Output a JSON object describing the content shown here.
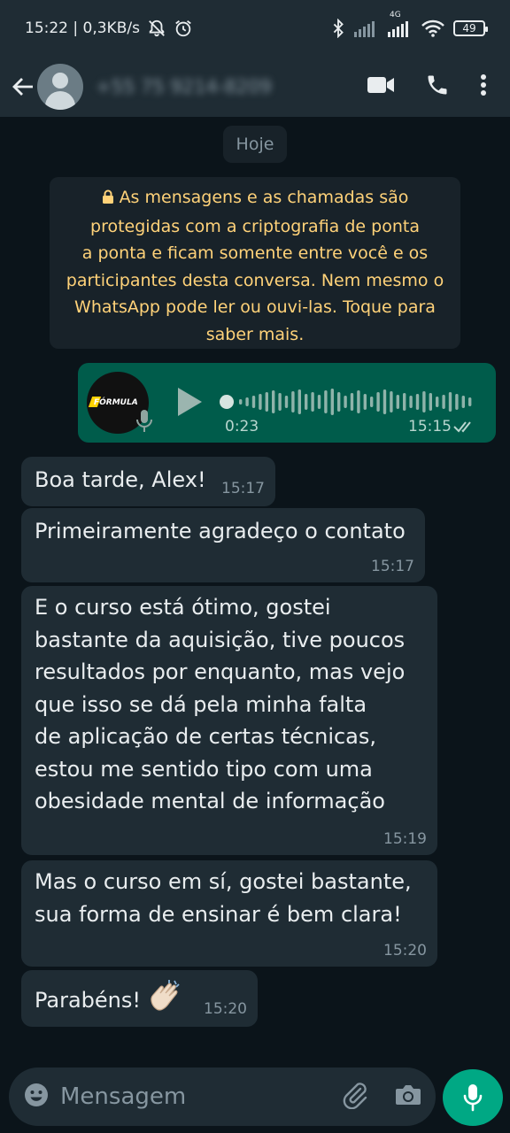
{
  "status_bar": {
    "time_speed": "15:22 | 0,3KB/s",
    "network": "4G",
    "battery": "49"
  },
  "header": {
    "contact_name": "+55 75 9214-8209"
  },
  "chat": {
    "date_chip": "Hoje",
    "encryption_notice": [
      "As mensagens e as chamadas são",
      "protegidas com a criptografia de ponta",
      "a ponta e ficam somente entre você e os",
      "participantes desta conversa. Nem mesmo o",
      "WhatsApp pode ler ou ouvi-las. Toque para",
      "saber mais."
    ],
    "audio": {
      "thumb_brand": "FÓRMULA",
      "duration": "0:23",
      "time": "15:15"
    },
    "messages": [
      {
        "lines": [
          "Boa tarde, Alex!"
        ],
        "time": "15:17"
      },
      {
        "lines": [
          "Primeiramente agradeço o contato"
        ],
        "time": "15:17"
      },
      {
        "lines": [
          "E o curso está ótimo, gostei",
          "bastante da aquisição, tive poucos",
          "resultados por enquanto, mas vejo",
          "que isso se dá pela minha falta",
          "de aplicação de certas técnicas,",
          "estou me sentido tipo com uma",
          "obesidade mental de informação"
        ],
        "time": "15:19"
      },
      {
        "lines": [
          "Mas o curso em sí, gostei bastante,",
          "sua forma de ensinar é bem clara!"
        ],
        "time": "15:20"
      },
      {
        "lines": [
          "Parabéns!"
        ],
        "time": "15:20",
        "emoji": "clapping-hands"
      }
    ]
  },
  "input": {
    "placeholder": "Mensagem"
  },
  "colors": {
    "background": "#0b141a",
    "bar": "#1f2c34",
    "incoming_bubble": "#1f2c34",
    "outgoing_bubble": "#005c4b",
    "notice_text": "#ffd279",
    "accent": "#00a884"
  }
}
